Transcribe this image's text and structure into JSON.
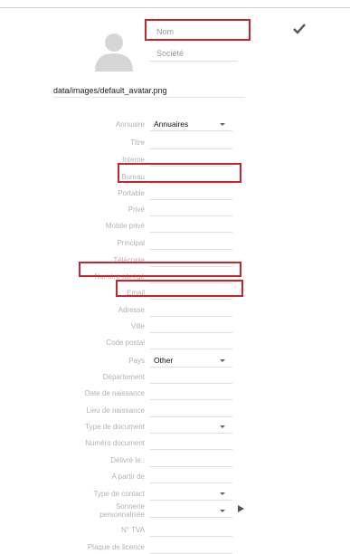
{
  "contact": {
    "name_placeholder": "Nom",
    "company_placeholder": "Société",
    "avatar_path": "data/images/default_avatar.png",
    "confirm_icon": "check-icon"
  },
  "fields": [
    {
      "label": "Annuaire",
      "value": "Annuaires",
      "dropdown": true
    },
    {
      "label": "Titre"
    },
    {
      "label": "Interne"
    },
    {
      "label": "Bureau"
    },
    {
      "label": "Portable"
    },
    {
      "label": "Privé"
    },
    {
      "label": "Mobile privé"
    },
    {
      "label": "Principal"
    },
    {
      "label": "Télécopie"
    },
    {
      "label": "Numéro abrégé"
    },
    {
      "label": "Email"
    },
    {
      "label": "Adresse"
    },
    {
      "label": "Ville"
    },
    {
      "label": "Code postal"
    },
    {
      "label": "Pays",
      "value": "Other",
      "dropdown": true
    },
    {
      "label": "Département"
    },
    {
      "label": "Date de naissance"
    },
    {
      "label": "Lieu de naissance"
    },
    {
      "label": "Type de document",
      "dropdown": true
    },
    {
      "label": "Numéro document"
    },
    {
      "label": "Délivré le :"
    },
    {
      "label": "A partir de"
    },
    {
      "label": "Type de contact",
      "dropdown": true
    },
    {
      "label": "Sonnerie personnalisée",
      "dropdown": true,
      "play": true
    },
    {
      "label": "N° TVA"
    },
    {
      "label": "Plaque de licence"
    }
  ],
  "highlight_color": "#c5262d"
}
